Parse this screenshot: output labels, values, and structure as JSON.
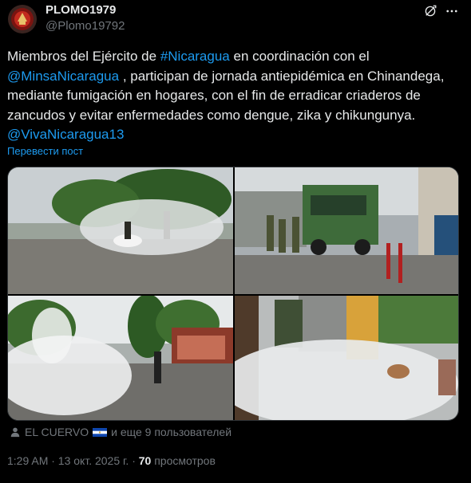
{
  "author": {
    "display_name": "PLOMO1979",
    "handle": "@Plomo19792",
    "avatar_icon": "red-emblem-icon"
  },
  "header_icons": [
    "grok-icon",
    "more-icon"
  ],
  "tweet": {
    "text_1": "Miembros del Ejército de ",
    "hashtag_1": "#Nicaragua",
    "text_2": " en coordinación con el ",
    "mention_1": "@MinsaNicaragua",
    "text_3": " , participan de jornada antiepidémica en Chinandega, mediante fumigación en hogares, con el fin de erradicar criaderos de zancudos y evitar enfermedades como dengue, zika y chikungunya. ",
    "hashtag_2": "@VivaNicaragua13",
    "translate_label": "Перевести пост"
  },
  "tagged": {
    "user": "EL CUERVO",
    "others": "и еще 9 пользователей"
  },
  "meta": {
    "timestamp": "1:29 AM · 13 окт. 2025 г. · ",
    "views_count": "70",
    "views_label": " просмотров"
  },
  "colors": {
    "background": "#000000",
    "text": "#e7e9ea",
    "secondary": "#71767b",
    "link": "#1d9bf0"
  }
}
